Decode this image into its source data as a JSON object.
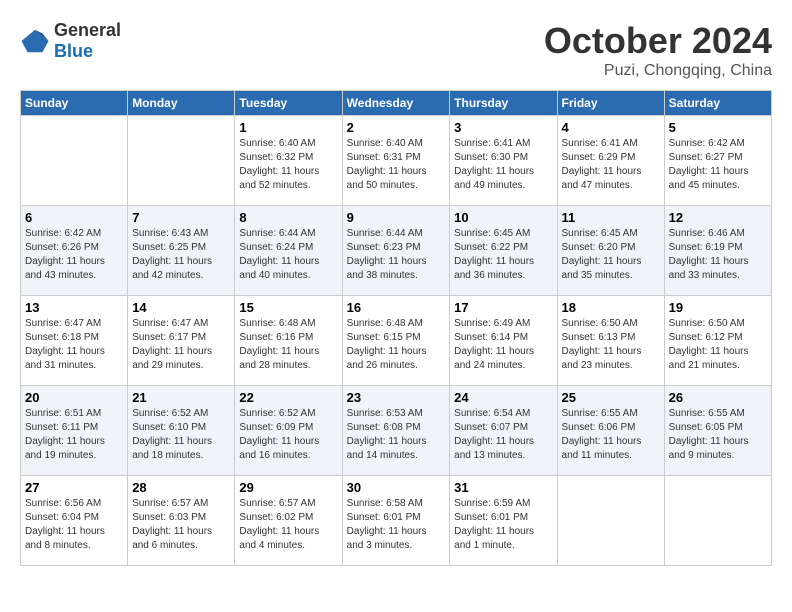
{
  "header": {
    "logo": {
      "general": "General",
      "blue": "Blue"
    },
    "title": "October 2024",
    "location": "Puzi, Chongqing, China"
  },
  "weekdays": [
    "Sunday",
    "Monday",
    "Tuesday",
    "Wednesday",
    "Thursday",
    "Friday",
    "Saturday"
  ],
  "weeks": [
    [
      {
        "day": "",
        "info": ""
      },
      {
        "day": "",
        "info": ""
      },
      {
        "day": "1",
        "info": "Sunrise: 6:40 AM\nSunset: 6:32 PM\nDaylight: 11 hours and 52 minutes."
      },
      {
        "day": "2",
        "info": "Sunrise: 6:40 AM\nSunset: 6:31 PM\nDaylight: 11 hours and 50 minutes."
      },
      {
        "day": "3",
        "info": "Sunrise: 6:41 AM\nSunset: 6:30 PM\nDaylight: 11 hours and 49 minutes."
      },
      {
        "day": "4",
        "info": "Sunrise: 6:41 AM\nSunset: 6:29 PM\nDaylight: 11 hours and 47 minutes."
      },
      {
        "day": "5",
        "info": "Sunrise: 6:42 AM\nSunset: 6:27 PM\nDaylight: 11 hours and 45 minutes."
      }
    ],
    [
      {
        "day": "6",
        "info": "Sunrise: 6:42 AM\nSunset: 6:26 PM\nDaylight: 11 hours and 43 minutes."
      },
      {
        "day": "7",
        "info": "Sunrise: 6:43 AM\nSunset: 6:25 PM\nDaylight: 11 hours and 42 minutes."
      },
      {
        "day": "8",
        "info": "Sunrise: 6:44 AM\nSunset: 6:24 PM\nDaylight: 11 hours and 40 minutes."
      },
      {
        "day": "9",
        "info": "Sunrise: 6:44 AM\nSunset: 6:23 PM\nDaylight: 11 hours and 38 minutes."
      },
      {
        "day": "10",
        "info": "Sunrise: 6:45 AM\nSunset: 6:22 PM\nDaylight: 11 hours and 36 minutes."
      },
      {
        "day": "11",
        "info": "Sunrise: 6:45 AM\nSunset: 6:20 PM\nDaylight: 11 hours and 35 minutes."
      },
      {
        "day": "12",
        "info": "Sunrise: 6:46 AM\nSunset: 6:19 PM\nDaylight: 11 hours and 33 minutes."
      }
    ],
    [
      {
        "day": "13",
        "info": "Sunrise: 6:47 AM\nSunset: 6:18 PM\nDaylight: 11 hours and 31 minutes."
      },
      {
        "day": "14",
        "info": "Sunrise: 6:47 AM\nSunset: 6:17 PM\nDaylight: 11 hours and 29 minutes."
      },
      {
        "day": "15",
        "info": "Sunrise: 6:48 AM\nSunset: 6:16 PM\nDaylight: 11 hours and 28 minutes."
      },
      {
        "day": "16",
        "info": "Sunrise: 6:48 AM\nSunset: 6:15 PM\nDaylight: 11 hours and 26 minutes."
      },
      {
        "day": "17",
        "info": "Sunrise: 6:49 AM\nSunset: 6:14 PM\nDaylight: 11 hours and 24 minutes."
      },
      {
        "day": "18",
        "info": "Sunrise: 6:50 AM\nSunset: 6:13 PM\nDaylight: 11 hours and 23 minutes."
      },
      {
        "day": "19",
        "info": "Sunrise: 6:50 AM\nSunset: 6:12 PM\nDaylight: 11 hours and 21 minutes."
      }
    ],
    [
      {
        "day": "20",
        "info": "Sunrise: 6:51 AM\nSunset: 6:11 PM\nDaylight: 11 hours and 19 minutes."
      },
      {
        "day": "21",
        "info": "Sunrise: 6:52 AM\nSunset: 6:10 PM\nDaylight: 11 hours and 18 minutes."
      },
      {
        "day": "22",
        "info": "Sunrise: 6:52 AM\nSunset: 6:09 PM\nDaylight: 11 hours and 16 minutes."
      },
      {
        "day": "23",
        "info": "Sunrise: 6:53 AM\nSunset: 6:08 PM\nDaylight: 11 hours and 14 minutes."
      },
      {
        "day": "24",
        "info": "Sunrise: 6:54 AM\nSunset: 6:07 PM\nDaylight: 11 hours and 13 minutes."
      },
      {
        "day": "25",
        "info": "Sunrise: 6:55 AM\nSunset: 6:06 PM\nDaylight: 11 hours and 11 minutes."
      },
      {
        "day": "26",
        "info": "Sunrise: 6:55 AM\nSunset: 6:05 PM\nDaylight: 11 hours and 9 minutes."
      }
    ],
    [
      {
        "day": "27",
        "info": "Sunrise: 6:56 AM\nSunset: 6:04 PM\nDaylight: 11 hours and 8 minutes."
      },
      {
        "day": "28",
        "info": "Sunrise: 6:57 AM\nSunset: 6:03 PM\nDaylight: 11 hours and 6 minutes."
      },
      {
        "day": "29",
        "info": "Sunrise: 6:57 AM\nSunset: 6:02 PM\nDaylight: 11 hours and 4 minutes."
      },
      {
        "day": "30",
        "info": "Sunrise: 6:58 AM\nSunset: 6:01 PM\nDaylight: 11 hours and 3 minutes."
      },
      {
        "day": "31",
        "info": "Sunrise: 6:59 AM\nSunset: 6:01 PM\nDaylight: 11 hours and 1 minute."
      },
      {
        "day": "",
        "info": ""
      },
      {
        "day": "",
        "info": ""
      }
    ]
  ]
}
